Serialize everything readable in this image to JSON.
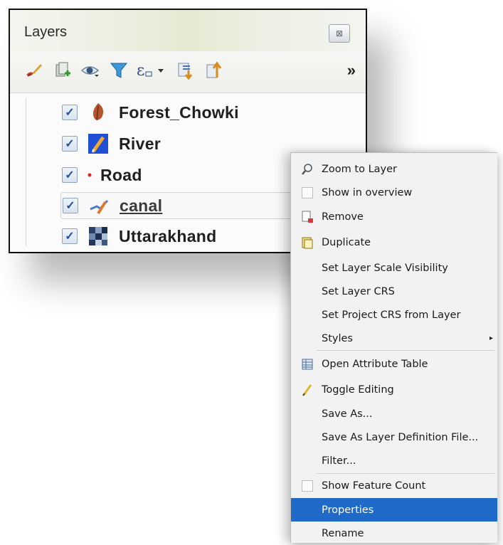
{
  "panel": {
    "title": "Layers",
    "close_glyph": "⊠",
    "more_glyph": "»",
    "toolbar_icons": [
      "open-layer-styling-icon",
      "add-group-icon",
      "manage-visibility-icon",
      "filter-legend-icon",
      "filter-expression-icon",
      "expand-all-icon",
      "collapse-all-icon"
    ]
  },
  "layers": [
    {
      "name": "Forest_Chowki",
      "checked": true,
      "icon": "forest-point-icon"
    },
    {
      "name": "River",
      "checked": true,
      "icon": "river-line-icon"
    },
    {
      "name": "Road",
      "checked": true,
      "icon": "road-point-icon"
    },
    {
      "name": "canal",
      "checked": true,
      "icon": "canal-line-icon",
      "selected": true
    },
    {
      "name": "Uttarakhand",
      "checked": true,
      "icon": "raster-icon"
    }
  ],
  "context_menu": {
    "items": [
      {
        "label": "Zoom to Layer",
        "icon": "zoom-icon"
      },
      {
        "label": "Show in overview",
        "icon": "checkbox-empty-icon"
      },
      {
        "label": "Remove",
        "icon": "remove-icon"
      },
      {
        "label": "Duplicate",
        "icon": "duplicate-icon"
      },
      {
        "label": "Set Layer Scale Visibility"
      },
      {
        "label": "Set Layer CRS"
      },
      {
        "label": "Set Project CRS from Layer"
      },
      {
        "label": "Styles",
        "submenu_arrow": "▸"
      },
      {
        "label": "Open Attribute Table",
        "icon": "table-icon"
      },
      {
        "label": "Toggle Editing",
        "icon": "pencil-icon"
      },
      {
        "label": "Save As..."
      },
      {
        "label": "Save As Layer Definition File..."
      },
      {
        "label": "Filter..."
      },
      {
        "label": "Show Feature Count",
        "icon": "checkbox-empty-icon"
      },
      {
        "label": "Properties",
        "highlighted": true
      },
      {
        "label": "Rename"
      }
    ],
    "highlight_color": "#1f69c9"
  }
}
